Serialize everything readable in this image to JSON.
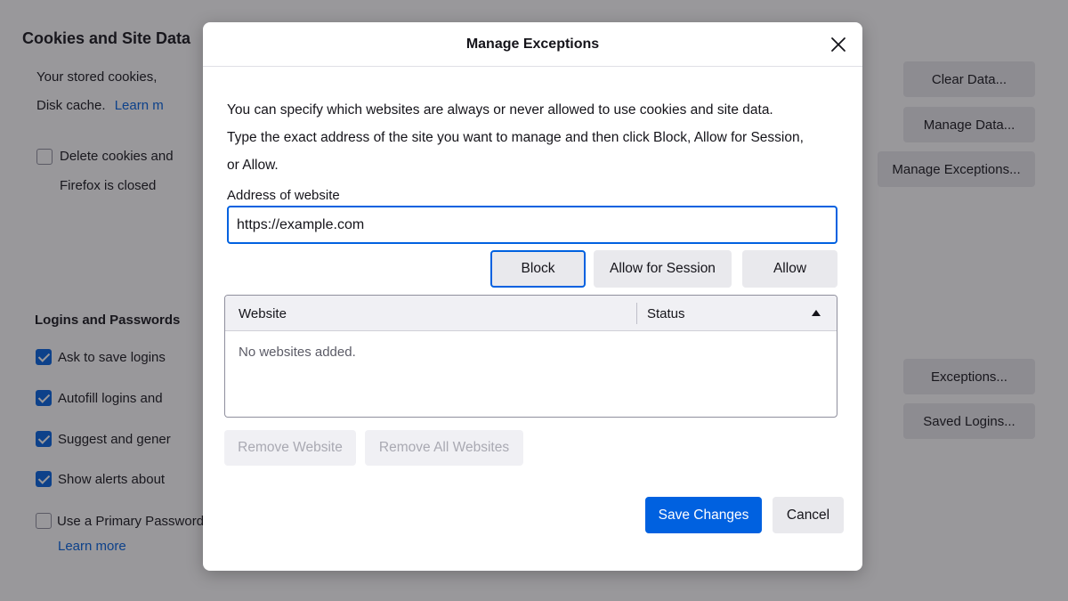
{
  "background": {
    "cookies_section": {
      "title": "Cookies and Site Data",
      "stored_text": "Your stored cookies,",
      "disk_cache_text": "Disk cache.",
      "learn_more": "Learn m",
      "delete_checkbox_label": "Delete cookies and",
      "delete_checkbox_label2": "Firefox is closed",
      "delete_checked": false,
      "buttons": {
        "clear_data": "Clear Data...",
        "manage_data": "Manage Data...",
        "manage_exceptions": "Manage Exceptions..."
      }
    },
    "logins_section": {
      "title": "Logins and Passwords",
      "items": [
        {
          "label": "Ask to save logins",
          "checked": true
        },
        {
          "label": "Autofill logins and",
          "checked": true
        },
        {
          "label": "Suggest and gener",
          "checked": true
        },
        {
          "label": "Show alerts about",
          "checked": true
        },
        {
          "label": "Use a Primary Password",
          "checked": false
        }
      ],
      "learn_more": "Learn more",
      "buttons": {
        "exceptions": "Exceptions...",
        "saved_logins": "Saved Logins..."
      }
    }
  },
  "dialog": {
    "title": "Manage Exceptions",
    "description_line1": "You can specify which websites are always or never allowed to use cookies and site data.",
    "description_line2": "Type the exact address of the site you want to manage and then click Block, Allow for Session,",
    "description_line3": "or Allow.",
    "address_label": "Address of website",
    "address_value": "https://example.com",
    "buttons": {
      "block": "Block",
      "allow_session": "Allow for Session",
      "allow": "Allow",
      "remove_website": "Remove Website",
      "remove_all": "Remove All Websites",
      "save": "Save Changes",
      "cancel": "Cancel"
    },
    "table": {
      "columns": [
        "Website",
        "Status"
      ],
      "sort_column": "Status",
      "sort_direction": "ascending",
      "empty_message": "No websites added."
    },
    "colors": {
      "accent": "#0061e0",
      "button_bg": "#e9e9ed",
      "disabled_text": "#a9a9b2"
    }
  }
}
